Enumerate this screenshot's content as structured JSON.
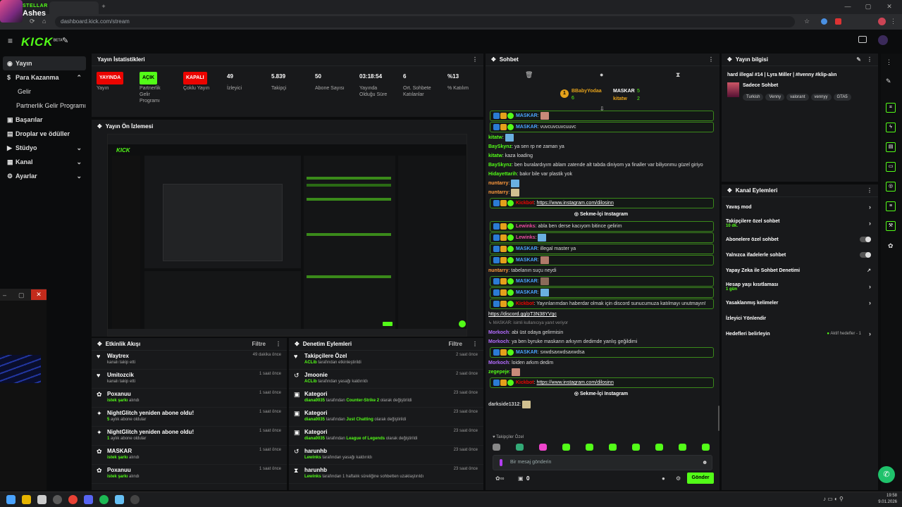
{
  "overlay": {
    "channel_small": "STELLAR",
    "name": "Ashes"
  },
  "browser": {
    "url": "dashboard.kick.com/stream",
    "window_controls": [
      "—",
      "▢",
      "✕"
    ]
  },
  "header": {
    "logo": "KICK",
    "logo_sup": "BETA"
  },
  "sidebar": {
    "items": [
      {
        "label": "Yayın",
        "icon": "broadcast-icon",
        "active": true
      },
      {
        "label": "Para Kazanma",
        "icon": "dollar-icon",
        "expanded": true
      },
      {
        "label": "Gelir",
        "sub": true
      },
      {
        "label": "Partnerlik Gelir Programı",
        "sub": true
      },
      {
        "label": "Başarılar",
        "icon": "trophy-icon"
      },
      {
        "label": "Droplar ve ödüller",
        "icon": "gift-icon"
      },
      {
        "label": "Stüdyo",
        "icon": "video-icon",
        "chevron": true
      },
      {
        "label": "Kanal",
        "icon": "channel-icon",
        "chevron": true
      },
      {
        "label": "Ayarlar",
        "icon": "gear-icon",
        "chevron": true
      }
    ]
  },
  "stats": {
    "title": "Yayın İstatistikleri",
    "items": [
      {
        "value": "YAYINDA",
        "label": "Yayın",
        "badge": "red"
      },
      {
        "value": "AÇIK",
        "label": "Partnerlik Gelir Programı",
        "badge": "green"
      },
      {
        "value": "KAPALI",
        "label": "Çoklu Yayın",
        "badge": "red"
      },
      {
        "value": "49",
        "label": "İzleyici"
      },
      {
        "value": "5.839",
        "label": "Takipçi"
      },
      {
        "value": "50",
        "label": "Abone Sayısı"
      },
      {
        "value": "03:18:54",
        "label": "Yayında Olduğu Süre"
      },
      {
        "value": "6",
        "label": "Ort. Sohbete Katılanlar"
      },
      {
        "value": "%13",
        "label": "% Katılım"
      }
    ]
  },
  "preview": {
    "title": "Yayın Ön İzlemesi"
  },
  "activity": {
    "title": "Etkinlik Akışı",
    "filter": "Filtre",
    "rows": [
      {
        "icon": "heart-icon",
        "title": "Waytrex",
        "sub": "kanalı takip etti",
        "time": "49 dakika önce"
      },
      {
        "icon": "heart-icon",
        "title": "Umitozcik",
        "sub": "kanalı takip etti",
        "time": "1 saat önce"
      },
      {
        "icon": "gift-icon",
        "title": "Poxanuu",
        "sub_b": "istek şarkı",
        "sub": "alındı",
        "time": "1 saat önce"
      },
      {
        "icon": "star-icon",
        "title": "NightGlitch yeniden abone oldu!",
        "sub_b": "5",
        "sub": "aylık abone oldular",
        "time": "1 saat önce"
      },
      {
        "icon": "star-icon",
        "title": "NightGlitch yeniden abone oldu!",
        "sub_b": "1",
        "sub": "aylık abone oldular",
        "time": "1 saat önce"
      },
      {
        "icon": "gift-icon",
        "title": "MASKAR",
        "sub_b": "istek şarkı",
        "sub": "alındı",
        "time": "1 saat önce"
      },
      {
        "icon": "gift-icon",
        "title": "Poxanuu",
        "sub_b": "istek şarkı",
        "sub": "alındı",
        "time": "1 saat önce"
      }
    ]
  },
  "moderation": {
    "title": "Denetim Eylemleri",
    "filter": "Filtre",
    "rows": [
      {
        "icon": "heart-icon",
        "title": "Takipçilere Özel",
        "sub_b": "ACLib",
        "sub": "tarafından etkinleştirildi",
        "time": "2 saat önce"
      },
      {
        "icon": "undo-icon",
        "title": "Jmoonie",
        "sub_b": "ACLib",
        "sub": "tarafından yasağı kaldırıldı",
        "time": "2 saat önce"
      },
      {
        "icon": "category-icon",
        "title": "Kategori",
        "sub_b": "diana0035",
        "sub": "tarafından",
        "sub_b2": "Counter-Strike 2",
        "sub2": "olarak değiştirildi",
        "time": "23 saat önce"
      },
      {
        "icon": "category-icon",
        "title": "Kategori",
        "sub_b": "diana0035",
        "sub": "tarafından",
        "sub_b2": "Just Chatting",
        "sub2": "olarak değiştirildi",
        "time": "23 saat önce"
      },
      {
        "icon": "category-icon",
        "title": "Kategori",
        "sub_b": "diana0035",
        "sub": "tarafından",
        "sub_b2": "League of Legends",
        "sub2": "olarak değiştirildi",
        "time": "23 saat önce"
      },
      {
        "icon": "undo-icon",
        "title": "harunhb",
        "sub_b": "Lewinks",
        "sub": "tarafından yasağı kaldırıldı",
        "time": "23 saat önce"
      },
      {
        "icon": "hourglass-icon",
        "title": "harunhb",
        "sub_b": "Lewinks",
        "sub": "tarafından 1 haftalık süreliğine sohbetten uzaklaştırıldı",
        "time": "23 saat önce"
      }
    ]
  },
  "chat": {
    "title": "Sohbet",
    "top_users": [
      {
        "name": "BBabyYodaa",
        "count": "6"
      },
      {
        "name": "MASKAR",
        "count": "5"
      },
      {
        "name": "kitatw",
        "count": "2"
      }
    ],
    "messages": [
      {
        "user": "MASKAR",
        "text": "",
        "boxed": true,
        "color": "#4aa3ff",
        "emote": true
      },
      {
        "user": "MASKAR",
        "text": "vuvcuvcuvcuuvc",
        "boxed": true,
        "color": "#4aa3ff"
      },
      {
        "user": "kitatw",
        "text": "",
        "color": "#53fc18",
        "emote": true
      },
      {
        "user": "BaySkynz",
        "text": "ya sen rp ne zaman ya",
        "color": "#53fc18"
      },
      {
        "user": "kitatw",
        "text": "kaza loading",
        "color": "#53fc18"
      },
      {
        "user": "BaySkynz",
        "text": "ben buralardıyım ablam zatende alt tabda diniyom ya finaller var biliyonmu güzel giriyo",
        "color": "#53fc18"
      },
      {
        "user": "Hidayettarih",
        "text": "bakır bile var plastik yok",
        "color": "#53fc18"
      },
      {
        "user": "nuntarry",
        "text": "",
        "color": "#ff9a3d",
        "emote": true
      },
      {
        "user": "nuntarry",
        "text": "",
        "color": "#ff9a3d",
        "emote": true
      },
      {
        "user": "Kickbot",
        "text": "https://www.instagram.com/dilosinn",
        "boxed": true,
        "color": "#eb0400",
        "link": true
      },
      {
        "ext": "Sekme-İçi Instagram"
      },
      {
        "user": "Lewinks",
        "text": "abla ben derse kacıyom bitince gelirim",
        "boxed": true,
        "color": "#eb4da0"
      },
      {
        "user": "Lewinks",
        "text": "",
        "boxed": true,
        "color": "#eb4da0",
        "emote": true
      },
      {
        "user": "MASKAR",
        "text": "illegal master ya",
        "boxed": true,
        "color": "#4aa3ff"
      },
      {
        "user": "MASKAR",
        "text": "",
        "boxed": true,
        "color": "#4aa3ff",
        "emote": true
      },
      {
        "user": "nuntarry",
        "text": "tabelanın suçu neydi",
        "color": "#ff9a3d"
      },
      {
        "user": "MASKAR",
        "text": "",
        "boxed": true,
        "color": "#4aa3ff",
        "emote": true
      },
      {
        "user": "MASKAR",
        "text": "",
        "boxed": true,
        "color": "#4aa3ff",
        "emote": true
      },
      {
        "user": "Kickbot",
        "text": "Yayınlarımdan haberdar olmak için discord sunucumuza katılmayı unutmayın!",
        "boxed": true,
        "color": "#eb0400"
      },
      {
        "plain": "https://discord.gg/pT3N38YVgc"
      },
      {
        "reply": "↳ MASKAR: isimli kullanıcıya yanıt veriyor"
      },
      {
        "user": "Morkoch",
        "text": "abi üst odaya gelirmisin",
        "color": "#b46cff"
      },
      {
        "user": "Morkoch",
        "text": "ya ben byruke maskarın arkıyım dedimde yanlış geğildimi",
        "color": "#b46cff"
      },
      {
        "user": "MASKAR",
        "text": "sxwdsaxwdsaxwdsa",
        "boxed": true,
        "color": "#4aa3ff"
      },
      {
        "user": "Morkoch",
        "text": "loiden arkım dedim",
        "color": "#b46cff"
      },
      {
        "user": "zegepeje",
        "text": "",
        "color": "#53fc18",
        "emote": true
      },
      {
        "user": "Kickbot",
        "text": "https://www.instagram.com/dilosinn",
        "boxed": true,
        "color": "#eb0400",
        "link": true
      },
      {
        "ext": "Sekme-İçi Instagram"
      },
      {
        "user": "darkside1312",
        "text": "",
        "color": "#cfcfcf",
        "emote": true
      }
    ],
    "followers_only": "Takipçiler Özel",
    "input_placeholder": "Bir mesaj gönderin",
    "points": "0",
    "send_label": "Gönder"
  },
  "stream_info": {
    "title": "Yayın bilgisi",
    "stream_title": "hard illegal #14 | Lyra Miller | #Ivenny #klip-alın",
    "chat_mode": "Sadece Sohbet",
    "tags": [
      "Turkish",
      "Venny",
      "valorant",
      "vennyy",
      "GTA5"
    ]
  },
  "channel_actions": {
    "title": "Kanal Eylemleri",
    "items": [
      {
        "label": "Yavaş mod",
        "control": "chevron"
      },
      {
        "label": "Takipçilere özel sohbet",
        "sub": "10 dk.",
        "control": "chevron"
      },
      {
        "label": "Abonelere özel sohbet",
        "control": "toggle"
      },
      {
        "label": "Yalnızca ifadelerle sohbet",
        "control": "toggle"
      },
      {
        "label": "Yapay Zeka ile Sohbet Denetimi",
        "control": "external"
      },
      {
        "label": "Hesap yaşı kısıtlaması",
        "sub": "1 gün",
        "control": "chevron"
      },
      {
        "label": "Yasaklanmış kelimeler",
        "control": "chevron"
      },
      {
        "label": "İzleyici Yönlendir",
        "control": "none"
      },
      {
        "label": "Hedefleri belirleyin",
        "extra": "Aktif hedefler - 1",
        "control": "chevron"
      }
    ]
  },
  "taskbar": {
    "time": "19:58",
    "date": "9.01.2026"
  }
}
